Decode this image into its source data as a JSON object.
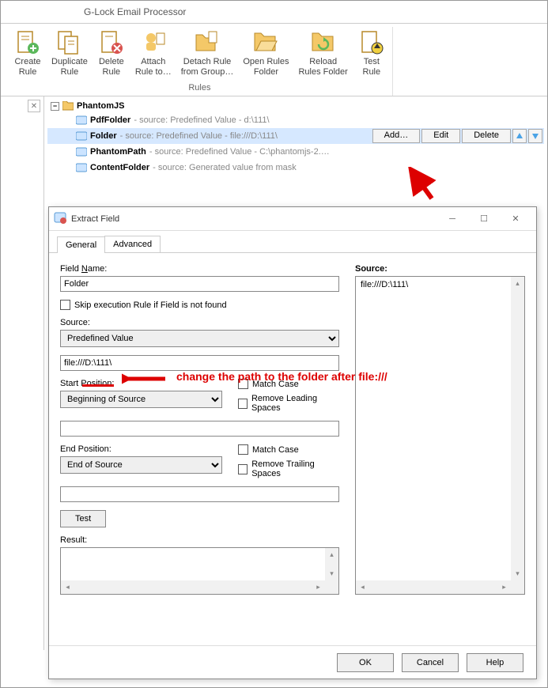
{
  "app": {
    "title": "G-Lock Email Processor"
  },
  "ribbon": {
    "group_label": "Rules",
    "buttons": {
      "create": {
        "label": "Create\nRule"
      },
      "duplicate": {
        "label": "Duplicate\nRule"
      },
      "delete": {
        "label": "Delete\nRule"
      },
      "attach": {
        "label": "Attach\nRule to…",
        "dropdown": true
      },
      "detach": {
        "label": "Detach Rule\nfrom Group…",
        "dropdown": true
      },
      "openfolder": {
        "label": "Open Rules\nFolder"
      },
      "reloadfolder": {
        "label": "Reload\nRules Folder"
      },
      "test": {
        "label": "Test\nRule"
      }
    }
  },
  "tree": {
    "root": "PhantomJS",
    "items": [
      {
        "name": "PdfFolder",
        "detail": " - source: Predefined Value - d:\\111\\"
      },
      {
        "name": "Folder",
        "detail": " - source: Predefined Value - file:///D:\\111\\",
        "selected": true
      },
      {
        "name": "PhantomPath",
        "detail": " - source: Predefined Value - C:\\phantomjs-2.…"
      },
      {
        "name": "ContentFolder",
        "detail": " - source: Generated value from mask"
      }
    ],
    "row_buttons": {
      "add": "Add…",
      "edit": "Edit",
      "delete": "Delete"
    }
  },
  "dialog": {
    "title": "Extract Field",
    "tabs": {
      "general": "General",
      "advanced": "Advanced"
    },
    "field_name_label": "Field Name:",
    "field_name_value": "Folder",
    "skip_label": "Skip execution Rule if Field is not found",
    "source_label": "Source:",
    "source_value": "Predefined Value",
    "path_value": "file:///D:\\111\\",
    "start_pos_label": "Start Position:",
    "start_pos_value": "Beginning of Source",
    "end_pos_label": "End Position:",
    "end_pos_value": "End of Source",
    "match_case": "Match Case",
    "remove_leading": "Remove Leading Spaces",
    "remove_trailing": "Remove Trailing Spaces",
    "test_btn": "Test",
    "result_label": "Result:",
    "source_panel_label": "Source:",
    "source_panel_value": "file:///D:\\111\\",
    "buttons": {
      "ok": "OK",
      "cancel": "Cancel",
      "help": "Help"
    }
  },
  "annotation": {
    "text": "change the path to the folder after file:///"
  }
}
